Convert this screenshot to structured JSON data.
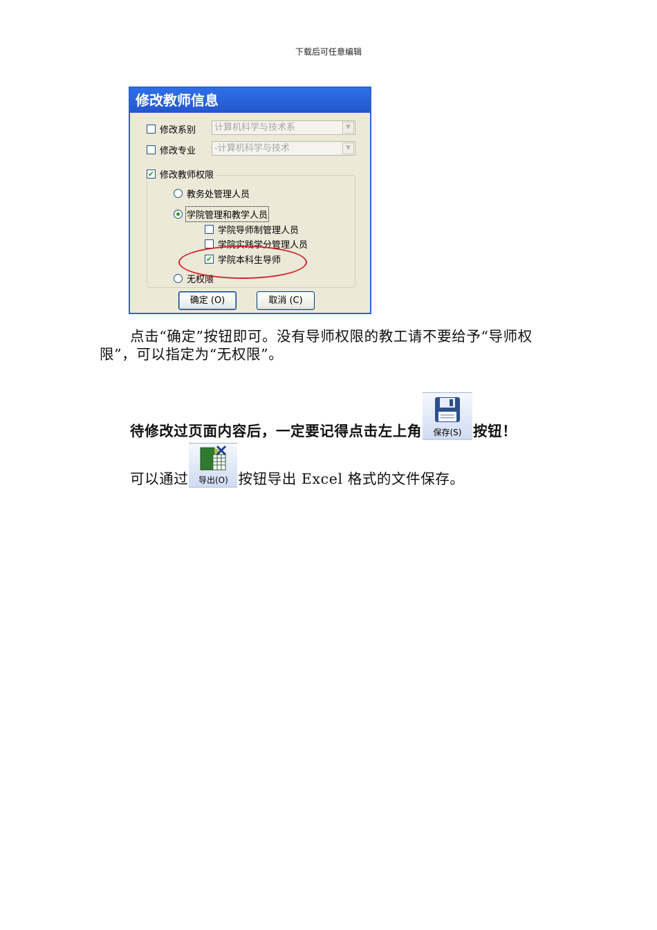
{
  "header": "下载后可任意编辑",
  "dialog": {
    "title": "修改教师信息",
    "modify_dept_label": "修改系别",
    "dept_value": "计算机科学与技术系",
    "modify_major_label": "修改专业",
    "major_value": "-计算机科学与技术",
    "modify_perm_label": "修改教师权限",
    "perm_option_1": "教务处管理人员",
    "perm_option_2": "学院管理和教学人员",
    "sub_option_1": "学院导师制管理人员",
    "sub_option_2": "学院实践学分管理人员",
    "sub_option_3": "学院本科生导师",
    "perm_option_3": "无权限",
    "ok_label": "确定 (O)",
    "cancel_label": "取消 (C)",
    "state": {
      "modify_dept_checked": false,
      "modify_major_checked": false,
      "modify_perm_checked": true,
      "selected_perm": "学院管理和教学人员",
      "sub_option_1_checked": false,
      "sub_option_2_checked": false,
      "sub_option_3_checked": true
    },
    "highlight_color": "#d4222a",
    "title_color": "#2456cc"
  },
  "para1": "点击“确定”按钮即可。没有导师权限的教工请不要给予“导师权限”，可以指定为“无权限”。",
  "para2_before": "待修改过页面内容后，一定要记得点击左上角",
  "save_button_label": "保存(S)",
  "para2_after": "按钮！",
  "para3_before": "可以通过",
  "export_button_label": "导出(O)",
  "para3_after": "按钮导出 Excel 格式的文件保存。",
  "icons": [
    "floppy-disk-icon",
    "excel-export-icon",
    "checkbox-checked-icon",
    "radio-selected-icon",
    "dropdown-arrow-icon"
  ]
}
